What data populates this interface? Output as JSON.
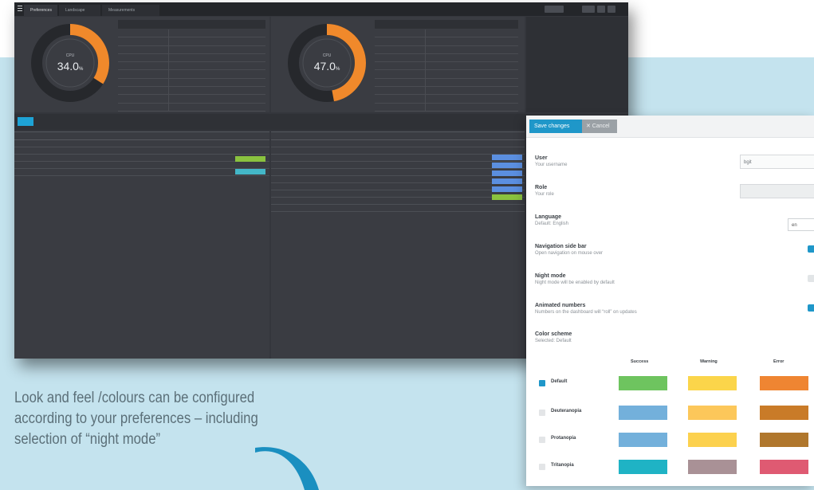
{
  "caption": {
    "line1": "Look and feel  /colours can be configured",
    "line2": "according to your preferences – including",
    "line3": "selection of “night mode”"
  },
  "dashboard": {
    "tabs": [
      "Preferences",
      "Landscape",
      "Measurements"
    ],
    "gauges": [
      {
        "label": "CPU",
        "value": "34.0",
        "unit": "%",
        "fraction": 0.34
      },
      {
        "label": "CPU",
        "value": "47.0",
        "unit": "%",
        "fraction": 0.47
      }
    ],
    "colors": {
      "gauge_fill": "#f0892b",
      "gauge_track": "#26282c",
      "accent": "#1ea3d6"
    }
  },
  "settings": {
    "toolbar": {
      "save_label": "Save changes",
      "cancel_label": "✕ Cancel"
    },
    "user": {
      "title": "User",
      "desc": "Your username",
      "value": "bgit"
    },
    "role": {
      "title": "Role",
      "desc": "Your role",
      "value": ""
    },
    "language": {
      "title": "Language",
      "desc": "Default: English",
      "value": "en"
    },
    "nav_side_bar": {
      "title": "Navigation side bar",
      "desc": "Open navigation on mouse over",
      "enabled": true
    },
    "night_mode": {
      "title": "Night mode",
      "desc": "Night mode will be enabled by default",
      "enabled": false
    },
    "animated_numbers": {
      "title": "Animated numbers",
      "desc": "Numbers on the dashboard will “roll” on updates",
      "enabled": true
    },
    "color_scheme": {
      "title": "Color scheme",
      "desc": "Selected: Default",
      "columns": [
        "Success",
        "Warning",
        "Error"
      ],
      "schemes": [
        {
          "name": "Default",
          "selected": true,
          "colors": [
            "#6ec45f",
            "#fbd54a",
            "#ef8532"
          ]
        },
        {
          "name": "Deuteranopia",
          "selected": false,
          "colors": [
            "#73b0db",
            "#fcc75a",
            "#c97b28"
          ]
        },
        {
          "name": "Protanopia",
          "selected": false,
          "colors": [
            "#73b0db",
            "#fcd14e",
            "#b0772d"
          ]
        },
        {
          "name": "Tritanopia",
          "selected": false,
          "colors": [
            "#1fb3c5",
            "#a99196",
            "#df5a72"
          ]
        }
      ]
    },
    "colors": {
      "primary": "#1f97c9",
      "cancel": "#9ba1a6"
    }
  }
}
